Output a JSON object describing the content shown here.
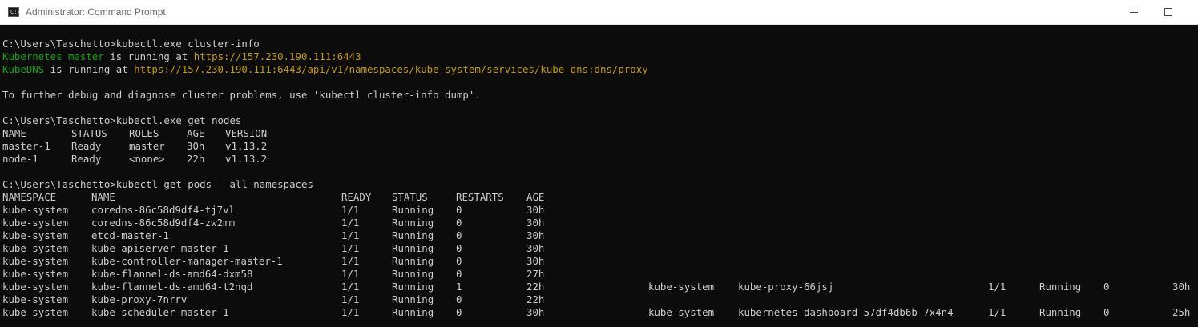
{
  "window": {
    "title": "Administrator: Command Prompt",
    "icon": "cmd-icon",
    "icon_text": "C:\\",
    "buttons": [
      "minimize-icon",
      "maximize-icon"
    ]
  },
  "colors": {
    "background": "#0c0c0c",
    "text": "#cccccc",
    "green": "#13a10e",
    "yellow": "#c19c00"
  },
  "console": {
    "cmd1": "C:\\Users\\Taschetto>kubectl.exe cluster-info",
    "info1": {
      "name": "Kubernetes master",
      "middle": " is running at ",
      "url": "https://157.230.190.111:6443"
    },
    "info2": {
      "name": "KubeDNS",
      "middle": " is running at ",
      "url": "https://157.230.190.111:6443/api/v1/namespaces/kube-system/services/kube-dns:dns/proxy"
    },
    "debug": "To further debug and diagnose cluster problems, use 'kubectl cluster-info dump'.",
    "cmd2": "C:\\Users\\Taschetto>kubectl.exe get nodes",
    "nodes_header": [
      "NAME",
      "STATUS",
      "ROLES",
      "AGE",
      "VERSION"
    ],
    "nodes": [
      [
        "master-1",
        "Ready",
        "master",
        "30h",
        "v1.13.2"
      ],
      [
        "node-1",
        "Ready",
        "<none>",
        "22h",
        "v1.13.2"
      ]
    ],
    "cmd3": "C:\\Users\\Taschetto>kubectl get pods --all-namespaces",
    "pods_header": [
      "NAMESPACE",
      "NAME",
      "READY",
      "STATUS",
      "RESTARTS",
      "AGE"
    ],
    "pods": [
      [
        "kube-system",
        "coredns-86c58d9df4-tj7vl",
        "1/1",
        "Running",
        "0",
        "30h"
      ],
      [
        "kube-system",
        "coredns-86c58d9df4-zw2mm",
        "1/1",
        "Running",
        "0",
        "30h"
      ],
      [
        "kube-system",
        "etcd-master-1",
        "1/1",
        "Running",
        "0",
        "30h"
      ],
      [
        "kube-system",
        "kube-apiserver-master-1",
        "1/1",
        "Running",
        "0",
        "30h"
      ],
      [
        "kube-system",
        "kube-controller-manager-master-1",
        "1/1",
        "Running",
        "0",
        "30h"
      ],
      [
        "kube-system",
        "kube-flannel-ds-amd64-dxm58",
        "1/1",
        "Running",
        "0",
        "27h"
      ],
      [
        "kube-system",
        "kube-flannel-ds-amd64-t2nqd",
        "1/1",
        "Running",
        "1",
        "22h"
      ],
      [
        "kube-system",
        "kube-proxy-7nrrv",
        "1/1",
        "Running",
        "0",
        "22h"
      ],
      [
        "kube-system",
        "kube-scheduler-master-1",
        "1/1",
        "Running",
        "0",
        "30h"
      ]
    ],
    "pods_overflow": [
      [
        "kube-system",
        "kube-proxy-66jsj",
        "1/1",
        "Running",
        "0",
        "30h"
      ],
      [
        "kube-system",
        "kubernetes-dashboard-57df4db6b-7x4n4",
        "1/1",
        "Running",
        "0",
        "25h"
      ]
    ]
  }
}
